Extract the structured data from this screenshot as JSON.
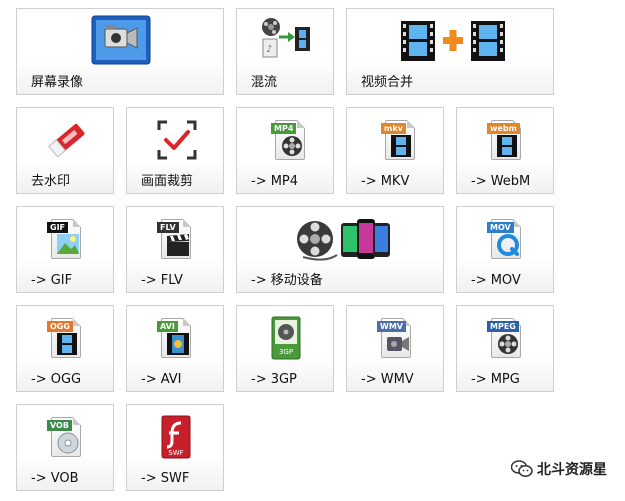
{
  "tiles": {
    "screen_record": "屏幕录像",
    "mix": "混流",
    "video_merge": "视频合并",
    "remove_watermark": "去水印",
    "crop": "画面裁剪",
    "mp4": "-> MP4",
    "mkv": "-> MKV",
    "webm": "-> WebM",
    "gif": "-> GIF",
    "flv": "-> FLV",
    "mobile": "-> 移动设备",
    "mov": "-> MOV",
    "ogg": "-> OGG",
    "avi": "-> AVI",
    "3gp": "-> 3GP",
    "wmv": "-> WMV",
    "mpg": "-> MPG",
    "vob": "-> VOB",
    "swf": "-> SWF"
  },
  "badges": {
    "mp4": "MP4",
    "mkv": "mkv",
    "webm": "webm",
    "gif": "GIF",
    "flv": "FLV",
    "mov": "MOV",
    "ogg": "OGG",
    "avi": "AVI",
    "3gp": "3GP",
    "wmv": "WMV",
    "mpg": "MPEG",
    "vob": "VOB",
    "swf": "SWF"
  },
  "watermark": "北斗资源星",
  "icons": {
    "screen_record": "camera-screen-icon",
    "mix": "mix-film-icon",
    "video_merge": "film-plus-film-icon",
    "remove_watermark": "eraser-icon",
    "crop": "crop-check-icon",
    "mobile": "reel-phones-icon"
  },
  "colors": {
    "mp4": "#4a9a3c",
    "mkv": "#e0862d",
    "webm": "#e0862d",
    "gif": "#111111",
    "flv": "#333333",
    "mov": "#2f7fc8",
    "ogg": "#e8762a",
    "avi": "#4a9a3c",
    "3gp": "#4a9a3c",
    "wmv": "#4d6fa8",
    "mpg": "#2b5fa8",
    "vob": "#3b8a4a",
    "swf": "#c8202a"
  }
}
